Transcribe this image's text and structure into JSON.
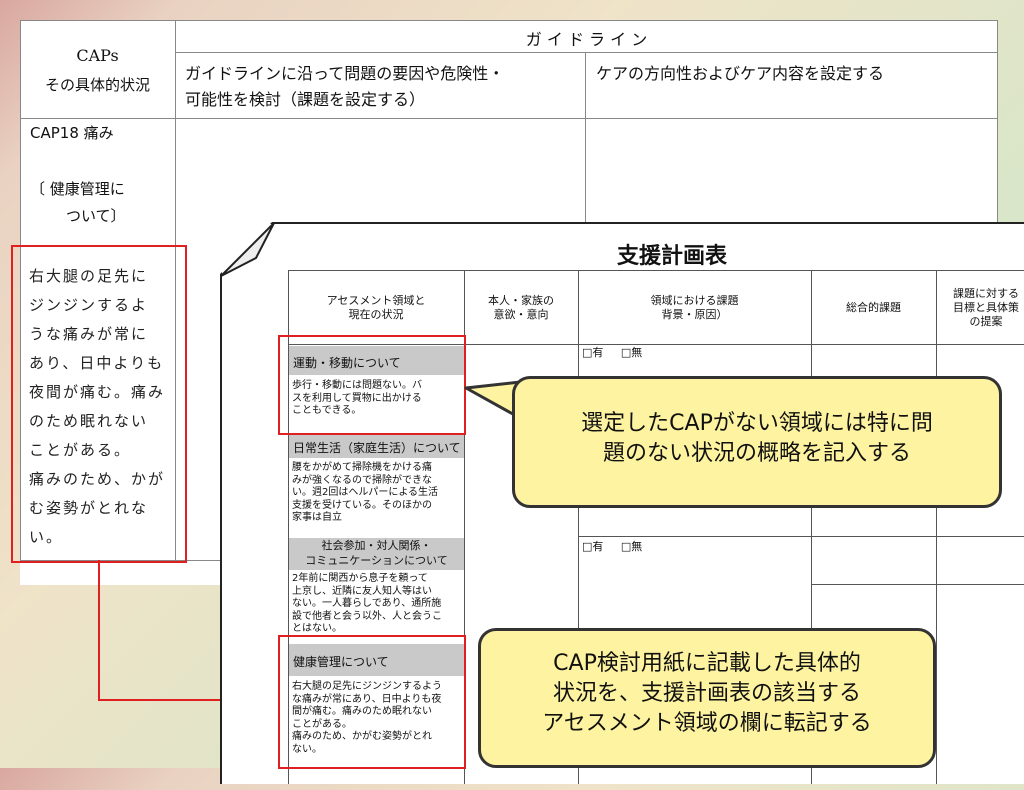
{
  "cap_table": {
    "caps_label": "CAPs",
    "situation_label": "その具体的状況",
    "guideline_header": "ガ イ ド ラ イ ン",
    "col1_line1": "ガイドラインに沿って問題の要因や危険性・",
    "col1_line2": "可能性を検討（課題を設定する）",
    "col2": "ケアの方向性およびケア内容を設定する",
    "cap_name": "CAP18 痛み",
    "topic_line1": "〔 健康管理に",
    "topic_line2": "ついて〕",
    "detail_lines": [
      "右大腿の足先に",
      "ジンジンするよ",
      "うな痛みが常に",
      "あり、日中よりも",
      "夜間が痛む。痛み",
      "のため眠れない",
      "ことがある。",
      "痛みのため、かが",
      "む姿勢がとれな",
      "い。"
    ]
  },
  "plan": {
    "title": "支援計画表",
    "headers": {
      "assess_1": "アセスメント領域と",
      "assess_2": "現在の状況",
      "intent_1": "本人・家族の",
      "intent_2": "意欲・意向",
      "issue_1": "領域における課題",
      "issue_2": "背景・原因）",
      "overall": "総合的課題",
      "goal_1": "課題に対する",
      "goal_2": "目標と具体策",
      "goal_3": "の提案"
    },
    "checkbox_yes": "□有",
    "checkbox_no": "□無",
    "sections": [
      {
        "title": "運動・移動について",
        "lines": [
          "歩行・移動には問題ない。バ",
          "スを利用して買物に出かける",
          "こともできる。"
        ]
      },
      {
        "title": "日常生活（家庭生活）について",
        "lines": [
          "腰をかがめて掃除機をかける痛",
          "みが強くなるので掃除ができな",
          "い。週2回はヘルパーによる生活",
          "支援を受けている。そのほかの",
          "家事は自立"
        ]
      },
      {
        "title_1": "社会参加・対人関係・",
        "title_2": "コミュニケーションについて",
        "lines": [
          "2年前に関西から息子を頼って",
          "上京し、近隣に友人知人等はい",
          "ない。一人暮らしであり、通所施",
          "設で他者と会う以外、人と会うこ",
          "とはない。"
        ]
      },
      {
        "title": "健康管理について",
        "lines": [
          "右大腿の足先にジンジンするよう",
          "な痛みが常にあり、日中よりも夜",
          "間が痛む。痛みのため眠れない",
          "ことがある。",
          "痛みのため、かがむ姿勢がとれ",
          "ない。"
        ]
      }
    ]
  },
  "callouts": {
    "top_line1": "選定したCAPがない領域には特に問",
    "top_line2": "題のない状況の概略を記入する",
    "bottom_line1": "CAP検討用紙に記載した具体的",
    "bottom_line2": "状況を、支援計画表の該当する",
    "bottom_line3": "アセスメント領域の欄に転記する"
  },
  "colors": {
    "highlight": "#e02020",
    "callout_fill": "#fdf3a0",
    "section_shade": "#c9c9c9"
  }
}
